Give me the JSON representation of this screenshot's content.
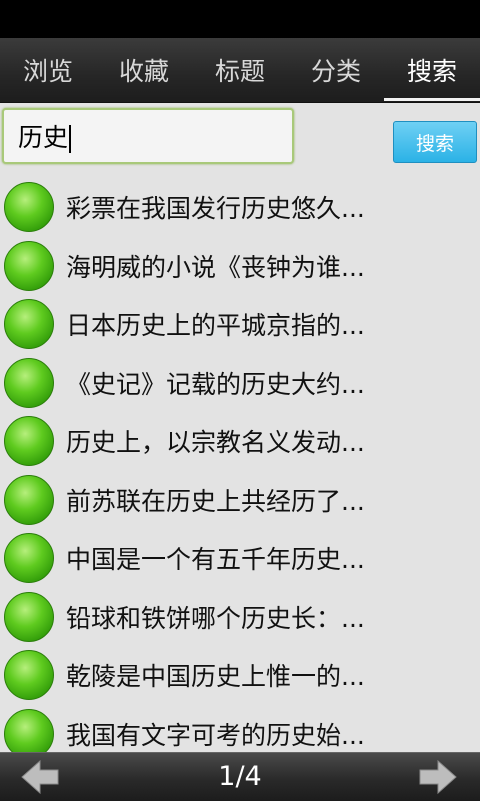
{
  "tabs": [
    {
      "label": "浏览"
    },
    {
      "label": "收藏"
    },
    {
      "label": "标题"
    },
    {
      "label": "分类"
    },
    {
      "label": "搜索",
      "active": true
    }
  ],
  "search": {
    "query": "历史",
    "button_label": "搜索"
  },
  "results": [
    "彩票在我国发行历史悠久...",
    "海明威的小说《丧钟为谁...",
    "日本历史上的平城京指的...",
    "《史记》记载的历史大约...",
    "历史上，以宗教名义发动...",
    "前苏联在历史上共经历了...",
    "中国是一个有五千年历史...",
    "铅球和铁饼哪个历史长：...",
    "乾陵是中国历史上惟一的...",
    "我国有文字可考的历史始..."
  ],
  "pagination": {
    "page": "1/4"
  },
  "colors": {
    "accent": "#2bb2e6",
    "bullet": "#5fcb1f",
    "input_border": "#a9c97a"
  }
}
